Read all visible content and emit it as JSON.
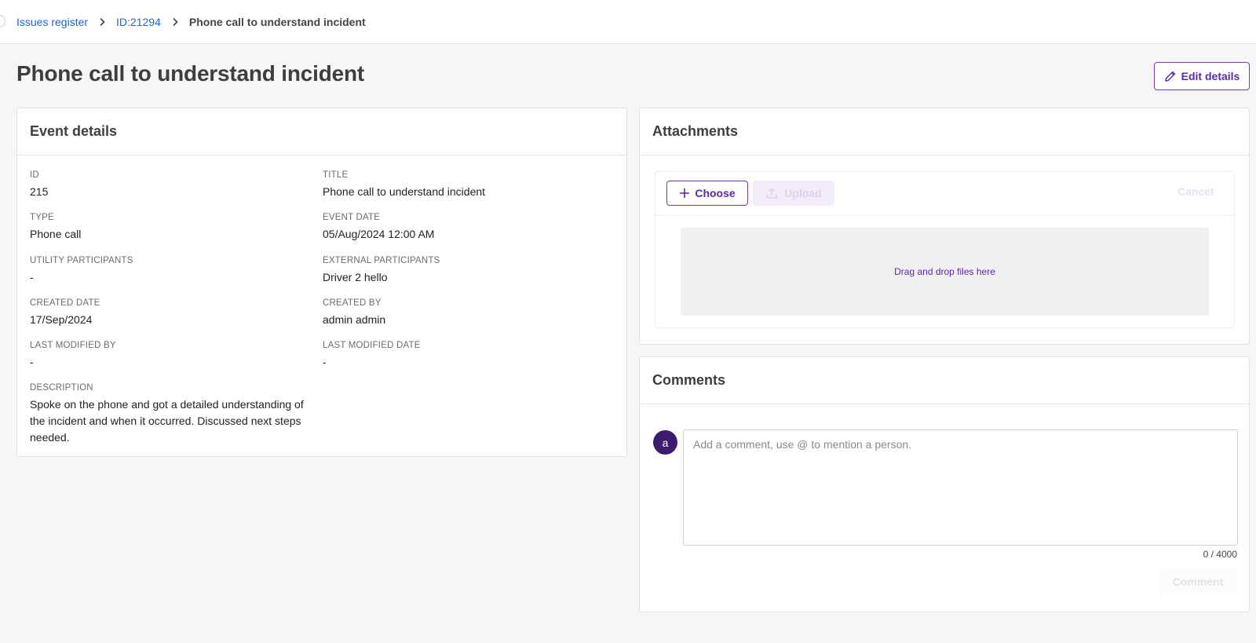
{
  "breadcrumb": {
    "items": [
      {
        "label": "Issues register"
      },
      {
        "label": "ID:21294"
      },
      {
        "label": "Phone call to understand incident"
      }
    ]
  },
  "page": {
    "title": "Phone call to understand incident",
    "edit_label": "Edit details"
  },
  "event_details": {
    "title": "Event details",
    "fields": [
      {
        "label": "ID",
        "value": "215"
      },
      {
        "label": "TITLE",
        "value": "Phone call to understand incident"
      },
      {
        "label": "TYPE",
        "value": "Phone call"
      },
      {
        "label": "EVENT DATE",
        "value": "05/Aug/2024 12:00 AM"
      },
      {
        "label": "UTILITY PARTICIPANTS",
        "value": "-"
      },
      {
        "label": "EXTERNAL PARTICIPANTS",
        "value": "Driver 2 hello"
      },
      {
        "label": "CREATED DATE",
        "value": "17/Sep/2024"
      },
      {
        "label": "CREATED BY",
        "value": "admin admin"
      },
      {
        "label": "LAST MODIFIED BY",
        "value": "-"
      },
      {
        "label": "LAST MODIFIED DATE",
        "value": "-"
      },
      {
        "label": "DESCRIPTION",
        "value": "Spoke on the phone and got a detailed understanding of the incident and when it occurred. Discussed next steps needed."
      }
    ]
  },
  "attachments": {
    "title": "Attachments",
    "choose_label": "Choose",
    "upload_label": "Upload",
    "cancel_label": "Cancel",
    "dropzone_text": "Drag and drop files here"
  },
  "comments": {
    "title": "Comments",
    "avatar_initial": "a",
    "placeholder": "Add a comment, use @ to mention a person.",
    "char_count": "0 / 4000",
    "submit_label": "Comment"
  },
  "colors": {
    "accent": "#5a2aa6",
    "link": "#1a66d6",
    "avatar": "#3b1c6e"
  }
}
